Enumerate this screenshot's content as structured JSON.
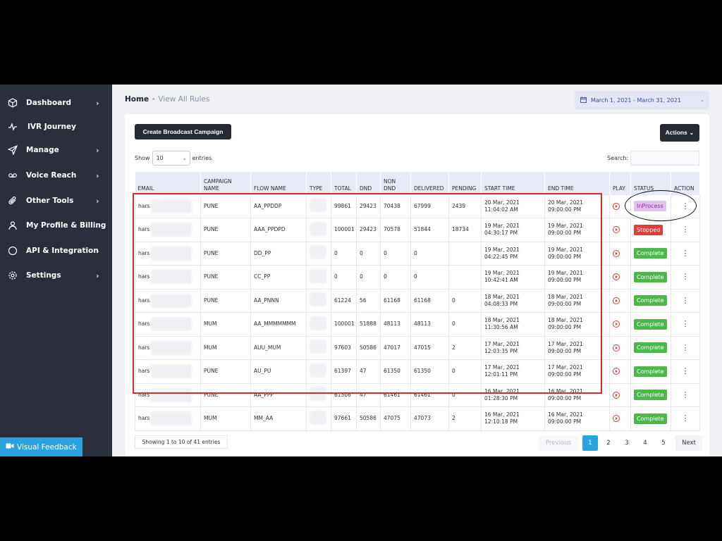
{
  "sidebar": {
    "items": [
      {
        "label": "Dashboard",
        "icon": "cube-icon",
        "chevron": true
      },
      {
        "label": "IVR Journey",
        "icon": "pulse-icon",
        "chevron": false
      },
      {
        "label": "Manage",
        "icon": "send-icon",
        "chevron": true
      },
      {
        "label": "Voice Reach",
        "icon": "voicemail-icon",
        "chevron": true
      },
      {
        "label": "Other Tools",
        "icon": "paperclip-icon",
        "chevron": true
      },
      {
        "label": "My Profile & Billing",
        "icon": "user-icon",
        "chevron": false
      },
      {
        "label": "API & Integration",
        "icon": "circle-icon",
        "chevron": true
      },
      {
        "label": "Settings",
        "icon": "gear-icon",
        "chevron": true
      }
    ],
    "feedback_label": "Visual Feedback"
  },
  "breadcrumb": {
    "home": "Home",
    "current": "View All Rules"
  },
  "daterange": "March 1, 2021 - March 31, 2021",
  "toolbar": {
    "create_label": "Create Broadcast Campaign",
    "actions_label": "Actions"
  },
  "controls": {
    "show_label": "Show",
    "entries_value": "10",
    "entries_label": "entries",
    "search_label": "Search:"
  },
  "table": {
    "headers": [
      "EMAIL",
      "CAMPAIGN NAME",
      "FLOW NAME",
      "TYPE",
      "TOTAL",
      "DND",
      "NON DND",
      "DELIVERED",
      "PENDING",
      "START TIME",
      "END TIME",
      "PLAY",
      "STATUS",
      "ACTION"
    ],
    "rows": [
      {
        "email": "hars",
        "campaign": "PUNE",
        "flow": "AA_PPDDP",
        "total": "99861",
        "dnd": "29423",
        "nondnd": "70438",
        "delivered": "67999",
        "pending": "2439",
        "start": "20 Mar, 2021 11:04:02 AM",
        "end": "20 Mar, 2021 09:00:00 PM",
        "status": "InProcess",
        "status_type": "inprocess"
      },
      {
        "email": "hars",
        "campaign": "PUNE",
        "flow": "AAA_PPDPD",
        "total": "100001",
        "dnd": "29423",
        "nondnd": "70578",
        "delivered": "51844",
        "pending": "18734",
        "start": "19 Mar, 2021 04:30:17 PM",
        "end": "19 Mar, 2021 09:00:00 PM",
        "status": "Stopped",
        "status_type": "stopped"
      },
      {
        "email": "hars",
        "campaign": "PUNE",
        "flow": "DD_PP",
        "total": "0",
        "dnd": "0",
        "nondnd": "0",
        "delivered": "0",
        "pending": "",
        "start": "19 Mar, 2021 04:22:45 PM",
        "end": "19 Mar, 2021 09:00:00 PM",
        "status": "Complete",
        "status_type": "complete"
      },
      {
        "email": "hars",
        "campaign": "PUNE",
        "flow": "CC_PP",
        "total": "0",
        "dnd": "0",
        "nondnd": "0",
        "delivered": "0",
        "pending": "",
        "start": "19 Mar, 2021 10:42:41 AM",
        "end": "19 Mar, 2021 09:00:00 PM",
        "status": "Complete",
        "status_type": "complete"
      },
      {
        "email": "hars",
        "campaign": "PUNE",
        "flow": "AA_PNNN",
        "total": "61224",
        "dnd": "56",
        "nondnd": "61168",
        "delivered": "61168",
        "pending": "0",
        "start": "18 Mar, 2021 04:08:33 PM",
        "end": "18 Mar, 2021 09:00:00 PM",
        "status": "Complete",
        "status_type": "complete"
      },
      {
        "email": "hars",
        "campaign": "MUM",
        "flow": "AA_MMMMMMM",
        "total": "100001",
        "dnd": "51888",
        "nondnd": "48113",
        "delivered": "48113",
        "pending": "0",
        "start": "18 Mar, 2021 11:30:56 AM",
        "end": "18 Mar, 2021 09:00:00 PM",
        "status": "Complete",
        "status_type": "complete"
      },
      {
        "email": "hars",
        "campaign": "MUM",
        "flow": "AUU_MUM",
        "total": "97603",
        "dnd": "50586",
        "nondnd": "47017",
        "delivered": "47015",
        "pending": "2",
        "start": "17 Mar, 2021 12:03:35 PM",
        "end": "17 Mar, 2021 09:00:00 PM",
        "status": "Complete",
        "status_type": "complete"
      },
      {
        "email": "hars",
        "campaign": "PUNE",
        "flow": "AU_PU",
        "total": "61397",
        "dnd": "47",
        "nondnd": "61350",
        "delivered": "61350",
        "pending": "0",
        "start": "17 Mar, 2021 12:01:11 PM",
        "end": "17 Mar, 2021 09:00:00 PM",
        "status": "Complete",
        "status_type": "complete"
      },
      {
        "email": "hars",
        "campaign": "PUNE",
        "flow": "AA_PPP",
        "total": "61508",
        "dnd": "47",
        "nondnd": "61461",
        "delivered": "61461",
        "pending": "0",
        "start": "16 Mar, 2021 01:28:30 PM",
        "end": "16 Mar, 2021 09:00:00 PM",
        "status": "Complete",
        "status_type": "complete"
      },
      {
        "email": "hars",
        "campaign": "MUM",
        "flow": "MM_AA",
        "total": "97661",
        "dnd": "50586",
        "nondnd": "47075",
        "delivered": "47073",
        "pending": "2",
        "start": "16 Mar, 2021 12:10:18 PM",
        "end": "16 Mar, 2021 09:00:00 PM",
        "status": "Complete",
        "status_type": "complete"
      }
    ]
  },
  "footer": {
    "info": "Showing 1 to 10 of 41 entries",
    "prev": "Previous",
    "pages": [
      "1",
      "2",
      "3",
      "4",
      "5"
    ],
    "next": "Next"
  },
  "colors": {
    "sidebar": "#2a2f3b",
    "accent": "#29a3e0",
    "complete": "#4cb84a",
    "stopped": "#e23b3b",
    "inprocess": "#e0c2ef",
    "annotation": "#d62c2c"
  }
}
